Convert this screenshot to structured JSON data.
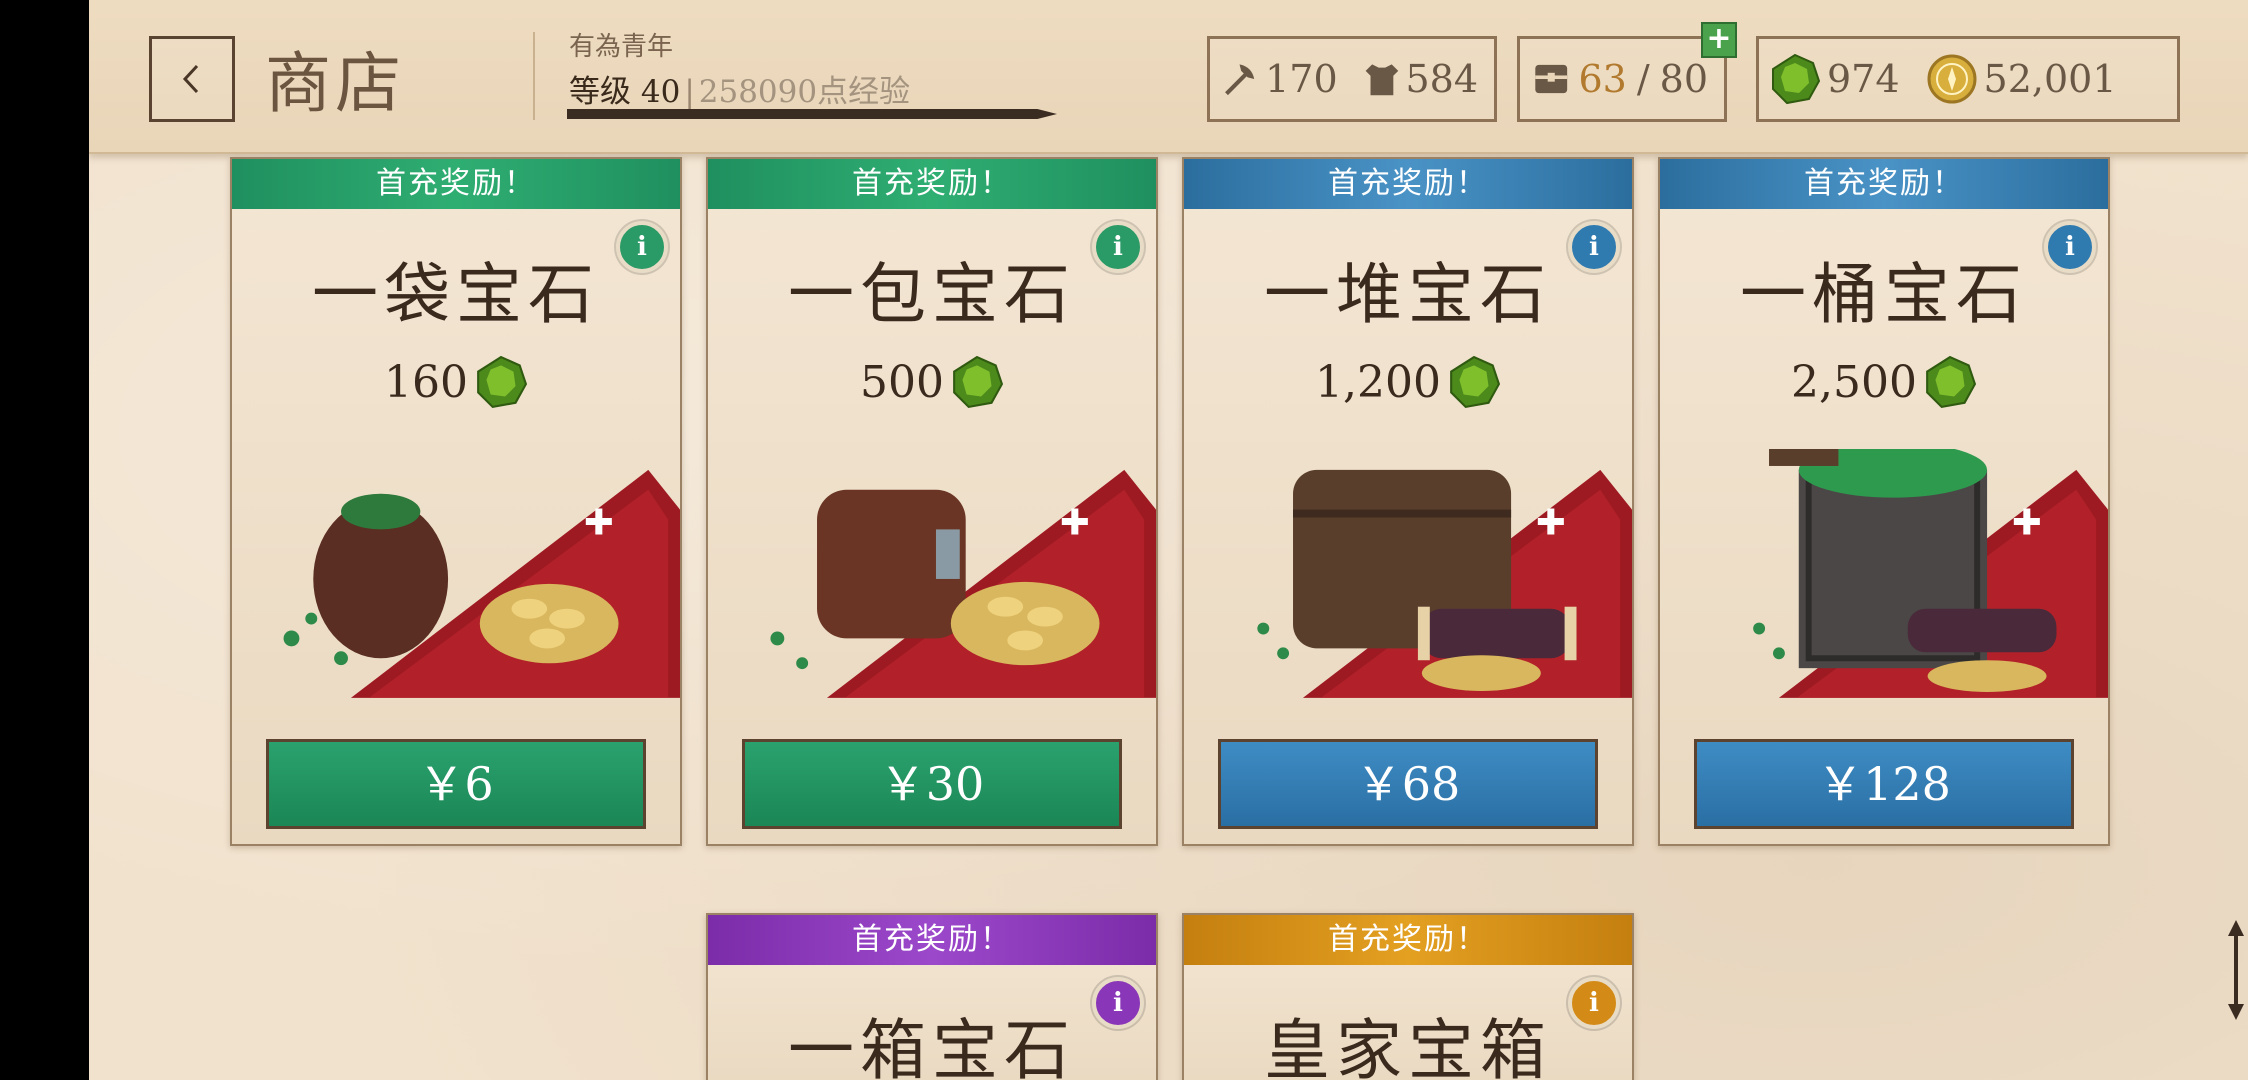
{
  "header": {
    "back_icon": "chevron-left-icon",
    "title": "商店",
    "rank_title": "有為青年",
    "level_label": "等级 40",
    "level_separator": "|",
    "xp_label": "258090点经验",
    "power": {
      "attack": "170",
      "armor": "584"
    },
    "inventory": {
      "current": "63",
      "separator": "/",
      "max": "80"
    },
    "currency": {
      "gems": "974",
      "gold": "52,001"
    },
    "plus_label": "+"
  },
  "cards": [
    {
      "banner": "首充奖励！",
      "title": "一袋宝石",
      "amount": "160",
      "price": "￥6",
      "theme": "green",
      "info": "i"
    },
    {
      "banner": "首充奖励！",
      "title": "一包宝石",
      "amount": "500",
      "price": "￥30",
      "theme": "green",
      "info": "i"
    },
    {
      "banner": "首充奖励！",
      "title": "一堆宝石",
      "amount": "1,200",
      "price": "￥68",
      "theme": "blue",
      "info": "i"
    },
    {
      "banner": "首充奖励！",
      "title": "一桶宝石",
      "amount": "2,500",
      "price": "￥128",
      "theme": "blue",
      "info": "i"
    },
    {
      "banner": "首充奖励！",
      "title": "一箱宝石",
      "theme": "purple",
      "info": "i"
    },
    {
      "banner": "首充奖励！",
      "title": "皇家宝箱",
      "theme": "orange",
      "info": "i"
    }
  ],
  "colors": {
    "parchment": "#f1e2cd",
    "green": "#2aa26e",
    "blue": "#3e8cc4",
    "purple": "#9c48cb",
    "orange": "#e3a021"
  }
}
